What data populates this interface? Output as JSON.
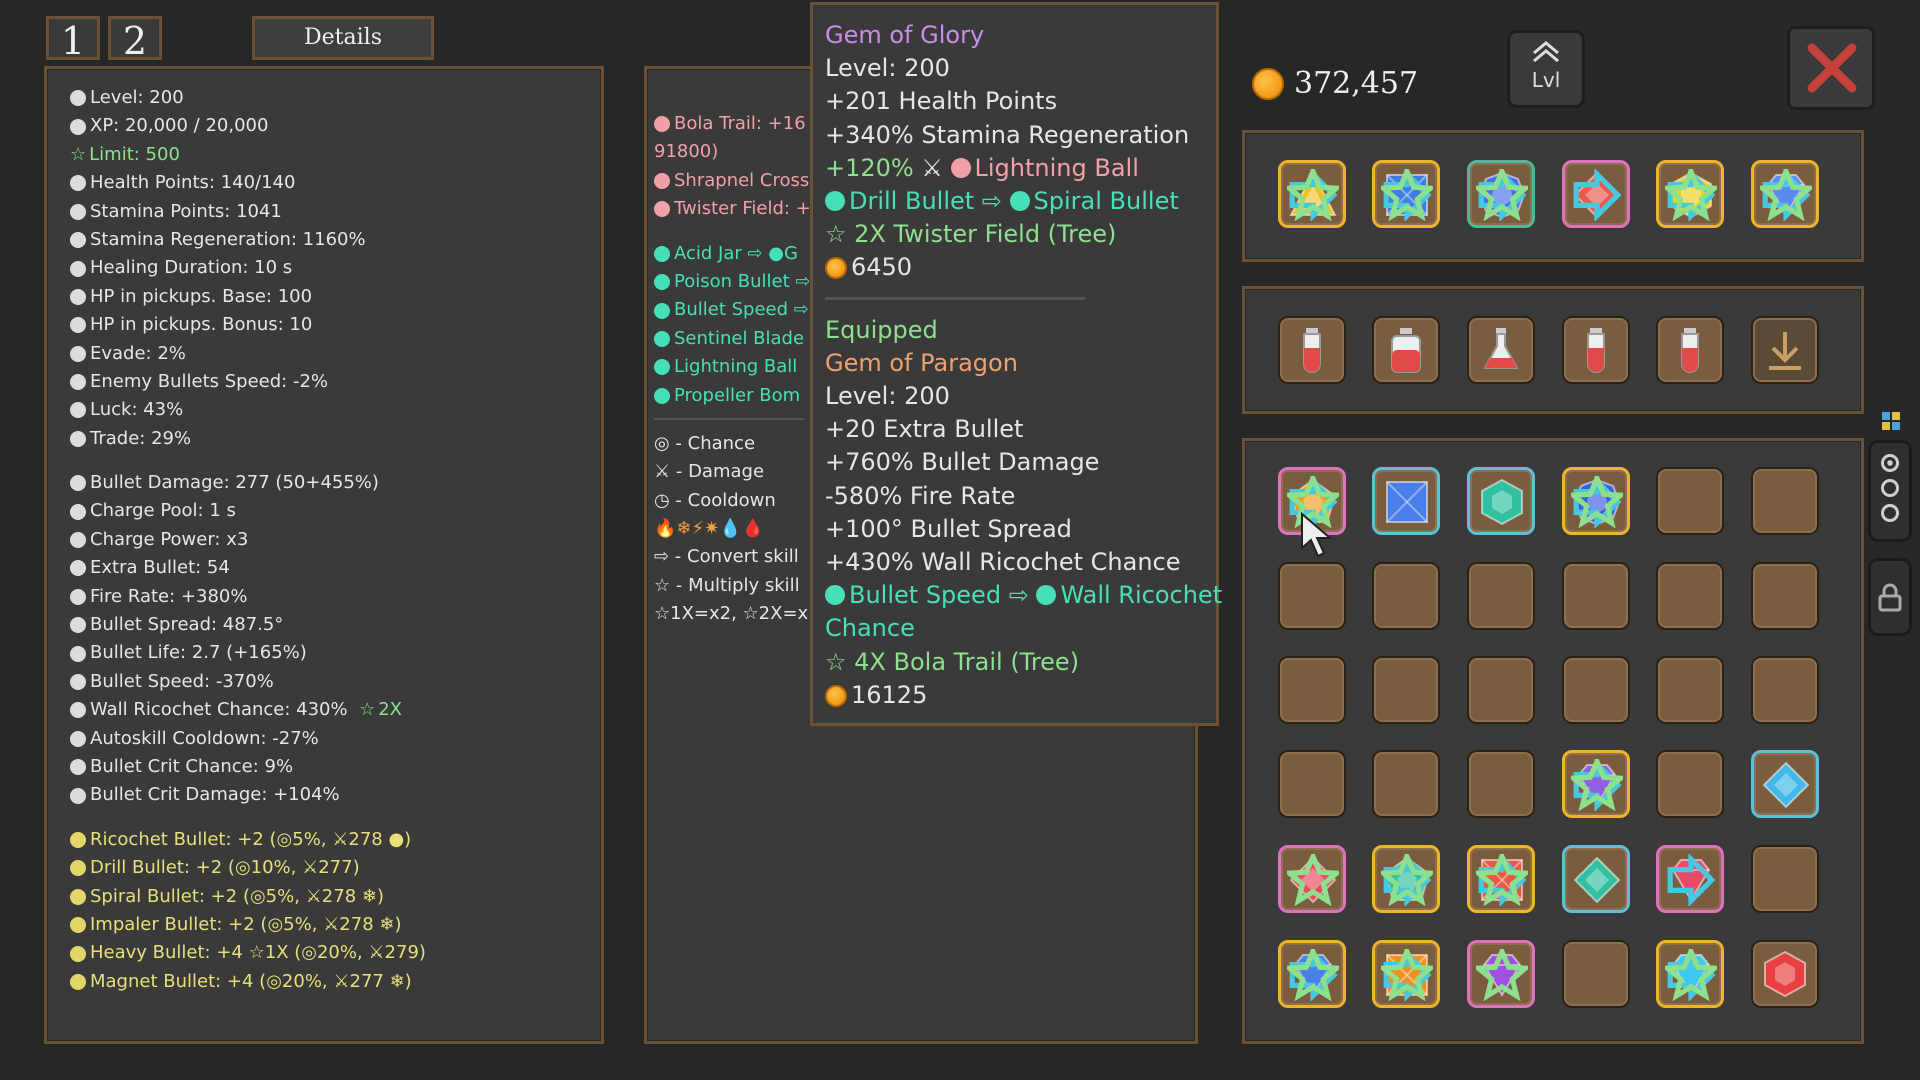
{
  "tabs": {
    "tab1": "1",
    "tab2": "2",
    "details": "Details"
  },
  "stats": [
    {
      "text": "Level: 200",
      "dot": "w"
    },
    {
      "text": "XP: 20,000 / 20,000",
      "dot": "w"
    },
    {
      "text": "Limit: 500",
      "dot": "star"
    },
    {
      "text": "Health Points: 140/140",
      "dot": "w"
    },
    {
      "text": "Stamina Points: 1041",
      "dot": "w"
    },
    {
      "text": "Stamina Regeneration: 1160%",
      "dot": "w"
    },
    {
      "text": "Healing Duration: 10 s",
      "dot": "w"
    },
    {
      "text": "HP in pickups. Base: 100",
      "dot": "w"
    },
    {
      "text": "HP in pickups. Bonus: 10",
      "dot": "w"
    },
    {
      "text": "Evade: 2%",
      "dot": "w"
    },
    {
      "text": "Enemy Bullets Speed: -2%",
      "dot": "w"
    },
    {
      "text": "Luck: 43%",
      "dot": "w"
    },
    {
      "text": "Trade: 29%",
      "dot": "w"
    }
  ],
  "stats2": [
    {
      "text": "Bullet Damage: 277 (50+455%)"
    },
    {
      "text": "Charge Pool: 1 s"
    },
    {
      "text": "Charge Power: x3"
    },
    {
      "text": "Extra Bullet: 54"
    },
    {
      "text": "Fire Rate: +380%"
    },
    {
      "text": "Bullet Spread: 487.5°"
    },
    {
      "text": "Bullet Life: 2.7 (+165%)"
    },
    {
      "text": "Bullet Speed: -370%"
    },
    {
      "text": "Wall Ricochet Chance: 430%",
      "extra": "2X"
    },
    {
      "text": "Autoskill Cooldown: -27%"
    },
    {
      "text": "Bullet Crit Chance: 9%"
    },
    {
      "text": "Bullet Crit Damage: +104%"
    }
  ],
  "skills": [
    "Ricochet Bullet: +2 (◎5%, ⚔278 ●)",
    "Drill Bullet: +2 (◎10%, ⚔277)",
    "Spiral Bullet: +2 (◎5%, ⚔278 ❄)",
    "Impaler Bullet: +2 (◎5%, ⚔278 ❄)",
    "Heavy Bullet: +4 ☆1X (◎20%, ⚔279)",
    "Magnet Bullet: +4 (◎20%, ⚔277 ❄)"
  ],
  "middle": {
    "pink_items": [
      "Bola Trail: +16",
      "91800)",
      "Shrapnel Cross",
      "Twister Field: +"
    ],
    "cyan_items": [
      "Acid Jar ⇨ ●G",
      "Poison Bullet ⇨",
      "Bullet Speed ⇨",
      "Sentinel Blade",
      "Lightning Ball",
      "Propeller Bom"
    ],
    "legend": [
      "◎ - Chance",
      "⚔ - Damage",
      "◷ - Cooldown",
      "🔥❄⚡✷💧🩸",
      "⇨ - Convert skill",
      "☆ - Multiply skill",
      "☆1X=x2, ☆2X=x"
    ]
  },
  "tooltip": {
    "name": "Gem of Glory",
    "level": "Level: 200",
    "l1": "+201 Health Points",
    "l2": "+340% Stamina Regeneration",
    "l3a": "+120%",
    "l3b": "Lightning Ball",
    "l4a": "Drill Bullet",
    "l4b": "Spiral Bullet",
    "l5": "2X Twister Field (Tree)",
    "price": "6450",
    "equipped": "Equipped",
    "eq_name": "Gem of Paragon",
    "eq_level": "Level: 200",
    "e1": "+20 Extra Bullet",
    "e2": "+760% Bullet Damage",
    "e3": "-580% Fire Rate",
    "e4": "+100° Bullet Spread",
    "e5": "+430% Wall Ricochet Chance",
    "e6a": "Bullet Speed",
    "e6b": "Wall Ricochet",
    "e6c": "Chance",
    "e7": "4X Bola Trail (Tree)",
    "eq_price": "16125"
  },
  "money": "372,457",
  "lvl_label": "Lvl",
  "colors": {
    "accent_green": "#8de08d",
    "purple": "#c98de8",
    "orange": "#f0a06a",
    "cyan": "#46e0b8",
    "pink": "#f3a0a8",
    "frame": "#6b5234"
  }
}
